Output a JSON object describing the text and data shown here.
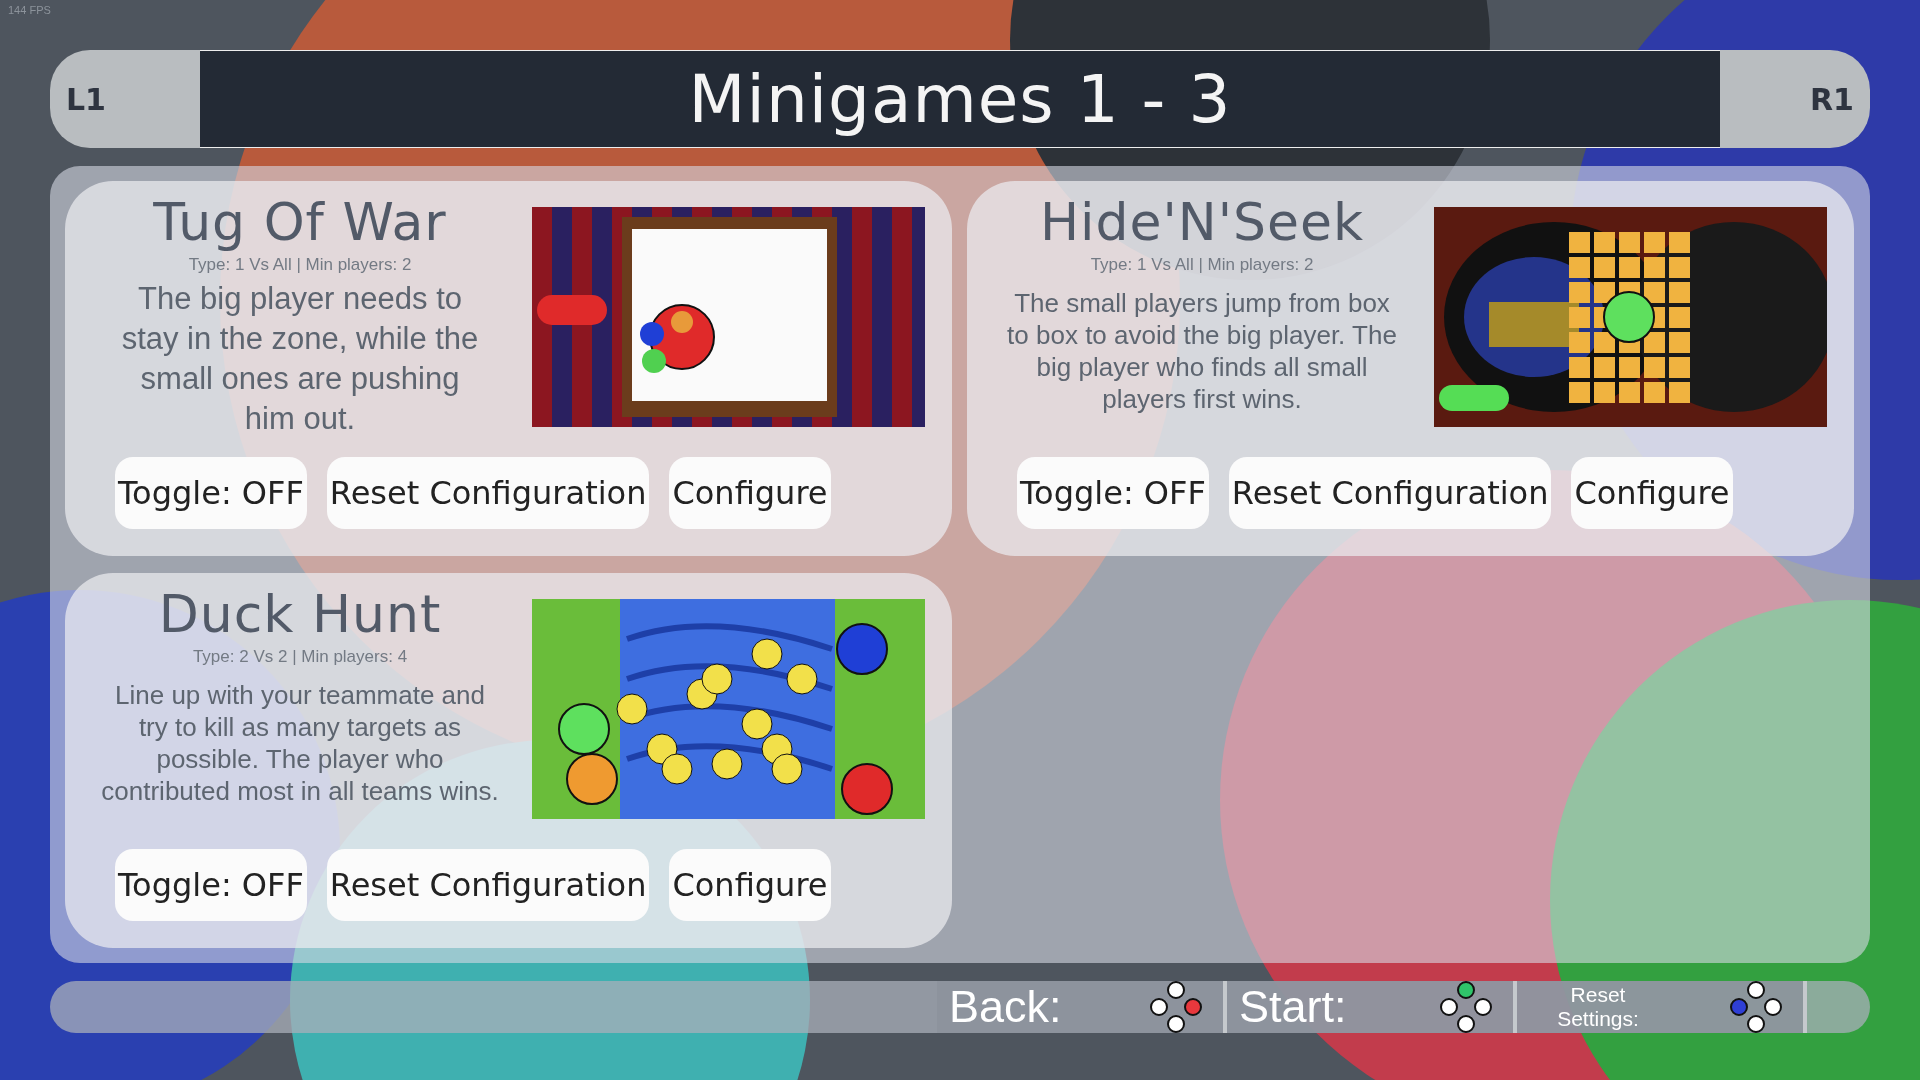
{
  "fps": "144 FPS",
  "header": {
    "left_shoulder": "L1",
    "title": "Minigames 1 - 3",
    "right_shoulder": "R1"
  },
  "minigames": [
    {
      "kind": "tug",
      "title": "Tug Of War",
      "meta": "Type: 1 Vs All | Min players: 2",
      "description": "The big player needs to stay in the zone, while the small ones are pushing him out.",
      "buttons": [
        "Toggle: OFF",
        "Reset Configuration",
        "Configure"
      ]
    },
    {
      "kind": "hide",
      "title": "Hide'N'Seek",
      "meta": "Type: 1 Vs All | Min players: 2",
      "description": "The small players jump from box to box to avoid the big player. The big player who finds all small players first wins.",
      "buttons": [
        "Toggle: OFF",
        "Reset Configuration",
        "Configure"
      ]
    },
    {
      "kind": "duck",
      "title": "Duck Hunt",
      "meta": "Type: 2 Vs 2 | Min players: 4",
      "description": "Line up with your teammate and try to kill as many targets as possible. The player who contributed most in all teams wins.",
      "buttons": [
        "Toggle: OFF",
        "Reset Configuration",
        "Configure"
      ]
    }
  ],
  "footer": [
    {
      "label": "Back:",
      "kind": "east",
      "color": "#e8383d"
    },
    {
      "label": "Start:",
      "kind": "north",
      "color": "#2fc46a"
    },
    {
      "label": "Reset Settings:",
      "kind": "west",
      "color": "#2f3fd6"
    }
  ]
}
